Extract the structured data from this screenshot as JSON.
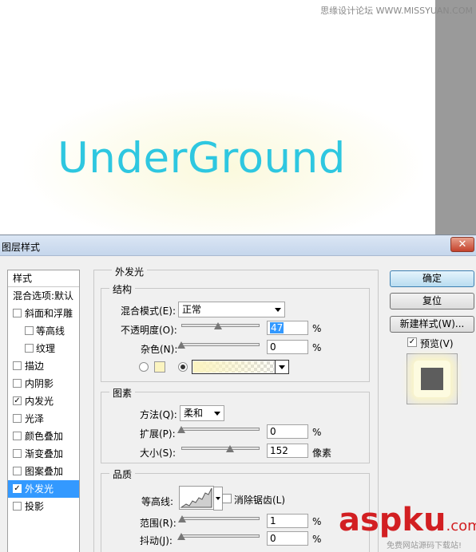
{
  "canvas": {
    "art_text": "UnderGround",
    "watermark_top": "思缘设计论坛 WWW.MISSYUAN.COM"
  },
  "dialog": {
    "title": "图层样式",
    "close_label": "✕"
  },
  "style_list": {
    "header": "样式",
    "blend_item": "混合选项:默认",
    "items": [
      {
        "label": "斜面和浮雕",
        "checked": false,
        "sub": false
      },
      {
        "label": "等高线",
        "checked": false,
        "sub": true
      },
      {
        "label": "纹理",
        "checked": false,
        "sub": true
      },
      {
        "label": "描边",
        "checked": false,
        "sub": false
      },
      {
        "label": "内阴影",
        "checked": false,
        "sub": false
      },
      {
        "label": "内发光",
        "checked": true,
        "sub": false
      },
      {
        "label": "光泽",
        "checked": false,
        "sub": false
      },
      {
        "label": "颜色叠加",
        "checked": false,
        "sub": false
      },
      {
        "label": "渐变叠加",
        "checked": false,
        "sub": false
      },
      {
        "label": "图案叠加",
        "checked": false,
        "sub": false
      },
      {
        "label": "外发光",
        "checked": true,
        "sub": false,
        "selected": true
      },
      {
        "label": "投影",
        "checked": false,
        "sub": false
      }
    ]
  },
  "panel": {
    "title": "外发光",
    "structure": {
      "title": "结构",
      "blend_mode_label": "混合模式(E):",
      "blend_mode_value": "正常",
      "opacity_label": "不透明度(O):",
      "opacity_value": "47",
      "opacity_unit": "%",
      "noise_label": "杂色(N):",
      "noise_value": "0",
      "noise_unit": "%",
      "glow_color": "#fbf4c0"
    },
    "elements": {
      "title": "图素",
      "technique_label": "方法(Q):",
      "technique_value": "柔和",
      "spread_label": "扩展(P):",
      "spread_value": "0",
      "spread_unit": "%",
      "size_label": "大小(S):",
      "size_value": "152",
      "size_unit": "像素"
    },
    "quality": {
      "title": "品质",
      "contour_label": "等高线:",
      "anti_alias_label": "消除锯齿(L)",
      "range_label": "范围(R):",
      "range_value": "1",
      "range_unit": "%",
      "jitter_label": "抖动(J):",
      "jitter_value": "0",
      "jitter_unit": "%"
    }
  },
  "buttons": {
    "ok": "确定",
    "reset": "复位",
    "new_style": "新建样式(W)...",
    "preview_label": "预览(V)"
  },
  "watermark": {
    "logo_main": "aspku",
    "logo_dot": ".com",
    "logo_sub": "免费网站源码下载站!"
  },
  "colors": {
    "text_accent": "#2ec7e0",
    "selection": "#3399ff",
    "watermark_red": "#d21f22"
  }
}
